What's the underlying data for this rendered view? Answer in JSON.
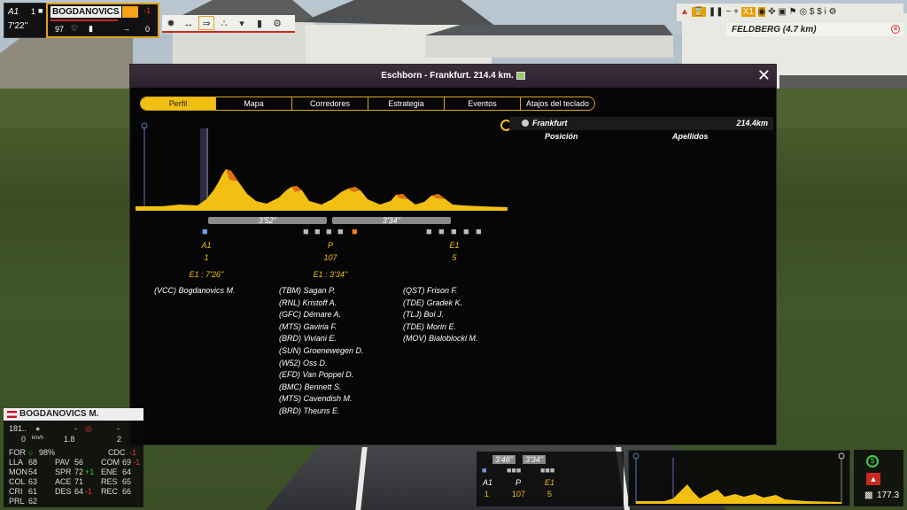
{
  "topleft": {
    "cat": "A1",
    "time": "7'22''",
    "num": "1"
  },
  "rider": {
    "name": "BOGDANOVICS M.",
    "delta": "-1",
    "energy": "97",
    "gap": "0"
  },
  "feldberg": "FELDBERG (4.7 km)",
  "toolbar_right": {
    "speed": "X1"
  },
  "modal": {
    "title": "Eschborn - Frankfurt. 214.4 km.",
    "tabs": [
      "Perfil",
      "Mapa",
      "Corredores",
      "Estrategia",
      "Eventos",
      "Atajos del teclado"
    ],
    "active_tab": "Perfil",
    "gaps": [
      "3'52''",
      "3'34''"
    ],
    "groups": [
      {
        "label": "A1",
        "count": "1",
        "time": "E1 : 7'26''",
        "riders": [
          "(VCC) Bogdanovics M."
        ]
      },
      {
        "label": "P",
        "count": "107",
        "time": "E1 : 3'34''",
        "riders": [
          "(TBM) Sagan P.",
          "(RNL) Kristoff A.",
          "(GFC) Démare A.",
          "(MTS) Gaviria F.",
          "(BRD) Viviani E.",
          "(SUN) Groenewegen D.",
          "(W52) Oss D.",
          "(EFD) Van Poppel D.",
          "(BMC) Bennett S.",
          "(MTS) Cavendish M.",
          "(BRD) Theuns E."
        ]
      },
      {
        "label": "E1",
        "count": "5",
        "time": "",
        "riders": [
          "(QST) Frison F.",
          "(TDE) Gradek K.",
          "(TLJ) Bol J.",
          "(TDE) Morin E.",
          "(MOV) Bialoblocki M."
        ]
      }
    ],
    "right": {
      "place": "Frankfurt",
      "distance": "214.4km",
      "col1": "Posición",
      "col2": "Apellidos"
    }
  },
  "bottom_left": {
    "name": "BOGDANOVICS M.",
    "r1": [
      "181..",
      "-",
      "-"
    ],
    "r2": [
      "0",
      "km/h",
      "1.8",
      "2"
    ],
    "form": "FOR",
    "form_val": "98%",
    "cdc": "CDC",
    "cdc_val": "-1",
    "stats": [
      [
        "LLA",
        "68",
        "PAV",
        "56",
        "COM",
        "69",
        "-1"
      ],
      [
        "MON",
        "54",
        "SPR",
        "72",
        "+1",
        "ENE",
        "64"
      ],
      [
        "COL",
        "63",
        "ACE",
        "71",
        "",
        "RES",
        "65"
      ],
      [
        "CRI",
        "61",
        "DES",
        "64",
        "-1",
        "REC",
        "66"
      ],
      [
        "PRL",
        "62"
      ]
    ]
  },
  "bottom_mini": {
    "gaps": [
      "3'48''",
      "3'34''"
    ],
    "labels": [
      "A1",
      "P",
      "E1"
    ],
    "counts": [
      "1",
      "107",
      "5"
    ]
  },
  "bottom_right": {
    "value": "177.3"
  }
}
